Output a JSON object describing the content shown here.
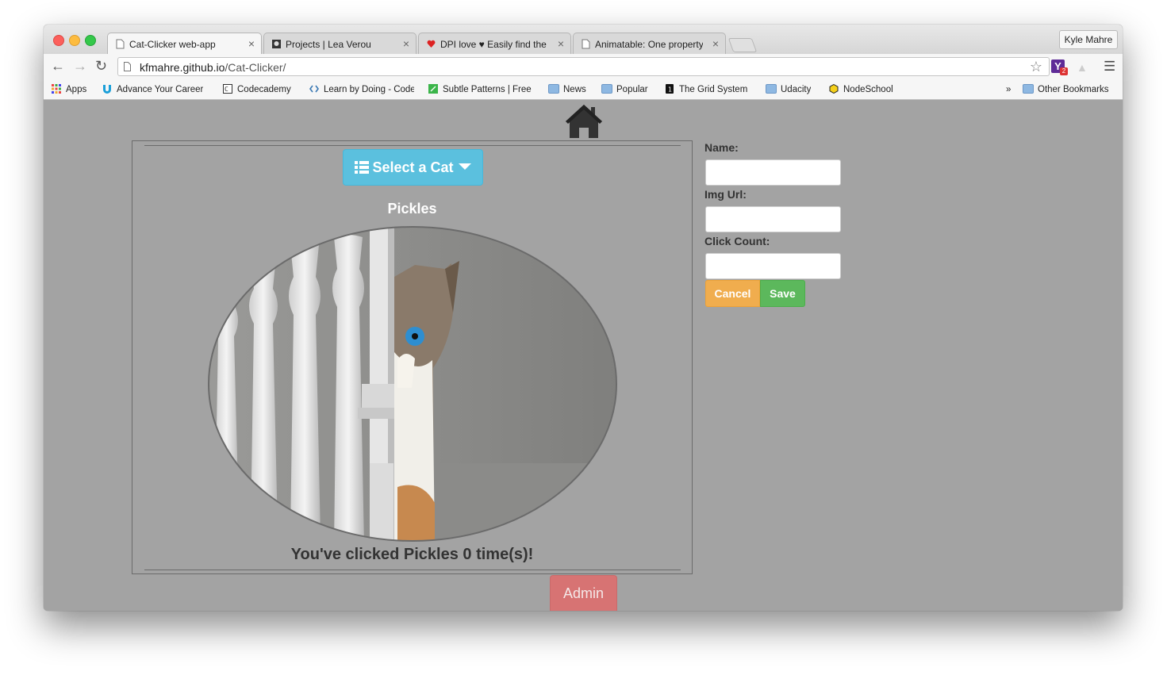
{
  "browser": {
    "tabs": [
      {
        "title": "Cat-Clicker web-app",
        "active": true
      },
      {
        "title": "Projects | Lea Verou",
        "active": false
      },
      {
        "title": "DPI love ♥ Easily find the D",
        "active": false
      },
      {
        "title": "Animatable: One property, t",
        "active": false
      }
    ],
    "profile_name": "Kyle Mahre",
    "url_host": "kfmahre.github.io",
    "url_path": "/Cat-Clicker/",
    "extension_badge": "2",
    "extension_letter": "Y",
    "bookmarks": [
      {
        "label": "Apps",
        "icon": "apps-grid-icon"
      },
      {
        "label": "Advance Your Career",
        "icon": "udemy-icon"
      },
      {
        "label": "Codecademy",
        "icon": "codecademy-icon"
      },
      {
        "label": "Learn by Doing - Code",
        "icon": "code-brackets-icon"
      },
      {
        "label": "Subtle Patterns | Free",
        "icon": "subtle-patterns-icon"
      },
      {
        "label": "News",
        "icon": "folder-icon"
      },
      {
        "label": "Popular",
        "icon": "folder-icon"
      },
      {
        "label": "The Grid System",
        "icon": "grid-system-icon"
      },
      {
        "label": "Udacity",
        "icon": "folder-icon"
      },
      {
        "label": "NodeSchool",
        "icon": "nodeschool-icon"
      }
    ],
    "overflow_chevron": "»",
    "other_bookmarks": "Other Bookmarks"
  },
  "app": {
    "select_button_label": "Select a Cat",
    "cat_name": "Pickles",
    "click_message": "You've clicked Pickles 0 time(s)!",
    "form": {
      "name_label": "Name:",
      "img_url_label": "Img Url:",
      "click_count_label": "Click Count:",
      "name_value": "",
      "img_url_value": "",
      "click_count_value": "",
      "cancel_label": "Cancel",
      "save_label": "Save"
    },
    "admin_label": "Admin"
  },
  "colors": {
    "page_background": "#a3a3a3",
    "select_button": "#5bc0de",
    "cancel_button": "#f0ad4e",
    "save_button": "#5cb85c",
    "admin_button": "#d77373"
  }
}
